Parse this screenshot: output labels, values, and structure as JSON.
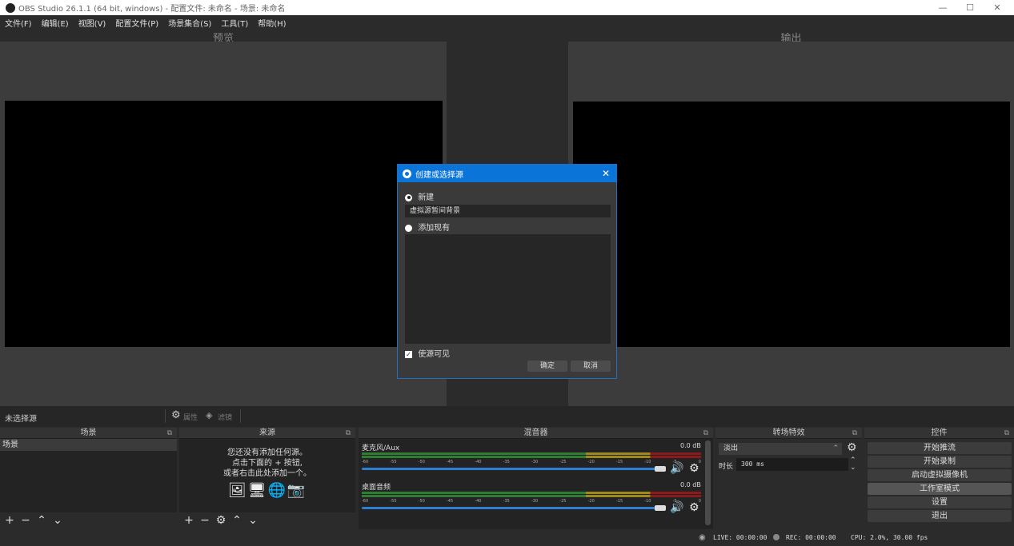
{
  "window": {
    "title": "OBS Studio 26.1.1 (64 bit, windows) - 配置文件: 未命名 - 场景: 未命名",
    "minimize": "—",
    "maximize": "☐",
    "close": "✕"
  },
  "menu": [
    "文件(F)",
    "编辑(E)",
    "视图(V)",
    "配置文件(P)",
    "场景集合(S)",
    "工具(T)",
    "帮助(H)"
  ],
  "preview": {
    "label": "预览"
  },
  "output": {
    "label": "输出"
  },
  "source_toolbar": {
    "no_selection": "未选择源",
    "properties": "属性",
    "filters": "滤镜"
  },
  "scenes": {
    "header": "场景",
    "items": [
      "场景"
    ]
  },
  "sources": {
    "header": "来源",
    "empty_line1": "您还没有添加任何源。",
    "empty_line2": "点击下面的 + 按钮,",
    "empty_line3": "或者右击此处添加一个。"
  },
  "mixer": {
    "header": "混音器",
    "ticks": [
      "-60",
      "-55",
      "-50",
      "-45",
      "-40",
      "-35",
      "-30",
      "-25",
      "-20",
      "-15",
      "-10",
      "-5",
      "0"
    ],
    "channels": [
      {
        "name": "麦克风/Aux",
        "db": "0.0 dB",
        "volume": 0.96
      },
      {
        "name": "桌面音频",
        "db": "0.0 dB",
        "volume": 0.96
      }
    ]
  },
  "transitions": {
    "header": "转场特效",
    "selected": "淡出",
    "duration_label": "时长",
    "duration_value": "300 ms"
  },
  "controls": {
    "header": "控件",
    "buttons": [
      "开始推流",
      "开始录制",
      "启动虚拟摄像机",
      "工作室模式",
      "设置",
      "退出"
    ]
  },
  "dialog": {
    "title": "创建或选择源",
    "new_label": "新建",
    "name_value": "虚拟源暂间背景",
    "existing_label": "添加现有",
    "visible_label": "使源可见",
    "ok": "确定",
    "cancel": "取消"
  },
  "status": {
    "live": "LIVE: 00:00:00",
    "rec": "REC: 00:00:00",
    "cpu": "CPU: 2.0%, 30.00 fps"
  }
}
